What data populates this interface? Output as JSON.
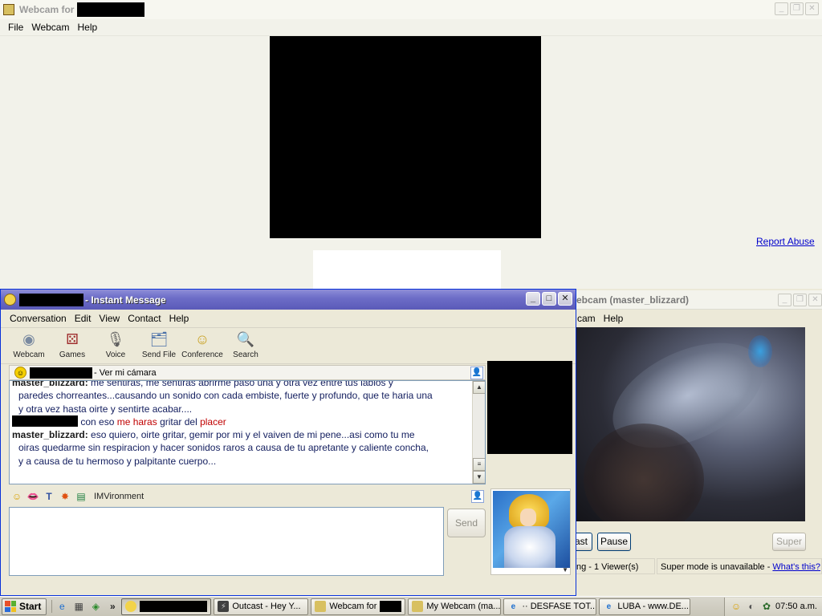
{
  "background_window": {
    "title_prefix": "Webcam for",
    "menu": [
      "File",
      "Webcam",
      "Help"
    ],
    "report_abuse": "Report Abuse"
  },
  "right_window": {
    "title": "ebcam (master_blizzard)",
    "menu": [
      "cam",
      "Help"
    ],
    "buttons": {
      "broadcast": "cast",
      "pause": "Pause",
      "super": "Super"
    },
    "status_left": "ng - 1 Viewer(s)",
    "status_right_text": "Super mode is unavailable - ",
    "status_right_link": "What's this?"
  },
  "im_window": {
    "title_suffix": "- Instant Message",
    "menu": [
      "Conversation",
      "Edit",
      "View",
      "Contact",
      "Help"
    ],
    "toolbar": [
      {
        "label": "Webcam",
        "icon": "webcam-icon",
        "glyph": "◉"
      },
      {
        "label": "Games",
        "icon": "games-icon",
        "glyph": "⚄"
      },
      {
        "label": "Voice",
        "icon": "microphone-icon",
        "glyph": "🎙"
      },
      {
        "label": "Send File",
        "icon": "send-file-icon",
        "glyph": "🗂"
      },
      {
        "label": "Conference",
        "icon": "conference-icon",
        "glyph": "☺"
      },
      {
        "label": "Search",
        "icon": "search-icon",
        "glyph": "🔍"
      }
    ],
    "conversation_caption": "- Ver mi cámara",
    "messages": {
      "m1_sender": "master_blizzard:",
      "m1_text": " me sentiras, me sentiras abrirme paso una y otra vez entre tus labios y",
      "m1_line2": "paredes chorreantes...causando un sonido con cada embiste, fuerte y profundo, que te haria una",
      "m1_line3": "y otra vez hasta oirte y sentirte acabar....",
      "m2_text_a": " con eso ",
      "m2_text_b": "me haras",
      "m2_text_c": " gritar del ",
      "m2_text_d": "placer",
      "m3_sender": "master_blizzard:",
      "m3_text": " eso quiero, oirte gritar, gemir por mi y el vaiven de mi pene...asi como tu me",
      "m3_line2": "oiras quedarme sin respiracion y hacer sonidos raros a causa de tu apretante y caliente concha,",
      "m3_line3": "y a causa de tu hermoso y palpitante cuerpo..."
    },
    "imvironment_label": "IMVironment",
    "send_label": "Send"
  },
  "taskbar": {
    "start_label": "Start",
    "tasks": [
      {
        "label": "Outcast - Hey Y...",
        "icon": "winamp-icon"
      },
      {
        "label": "Webcam for",
        "icon": "webcam-icon"
      },
      {
        "label": "My Webcam (ma...",
        "icon": "webcam-icon"
      },
      {
        "label": "·· DESFASE TOT...",
        "icon": "ie-icon"
      },
      {
        "label": "LUBA - www.DE...",
        "icon": "ie-icon"
      }
    ],
    "clock": "07:50 a.m."
  },
  "colors": {
    "im_title_bar": "#6e6ec8",
    "link": "#0000cc",
    "red_message": "#c00000"
  }
}
